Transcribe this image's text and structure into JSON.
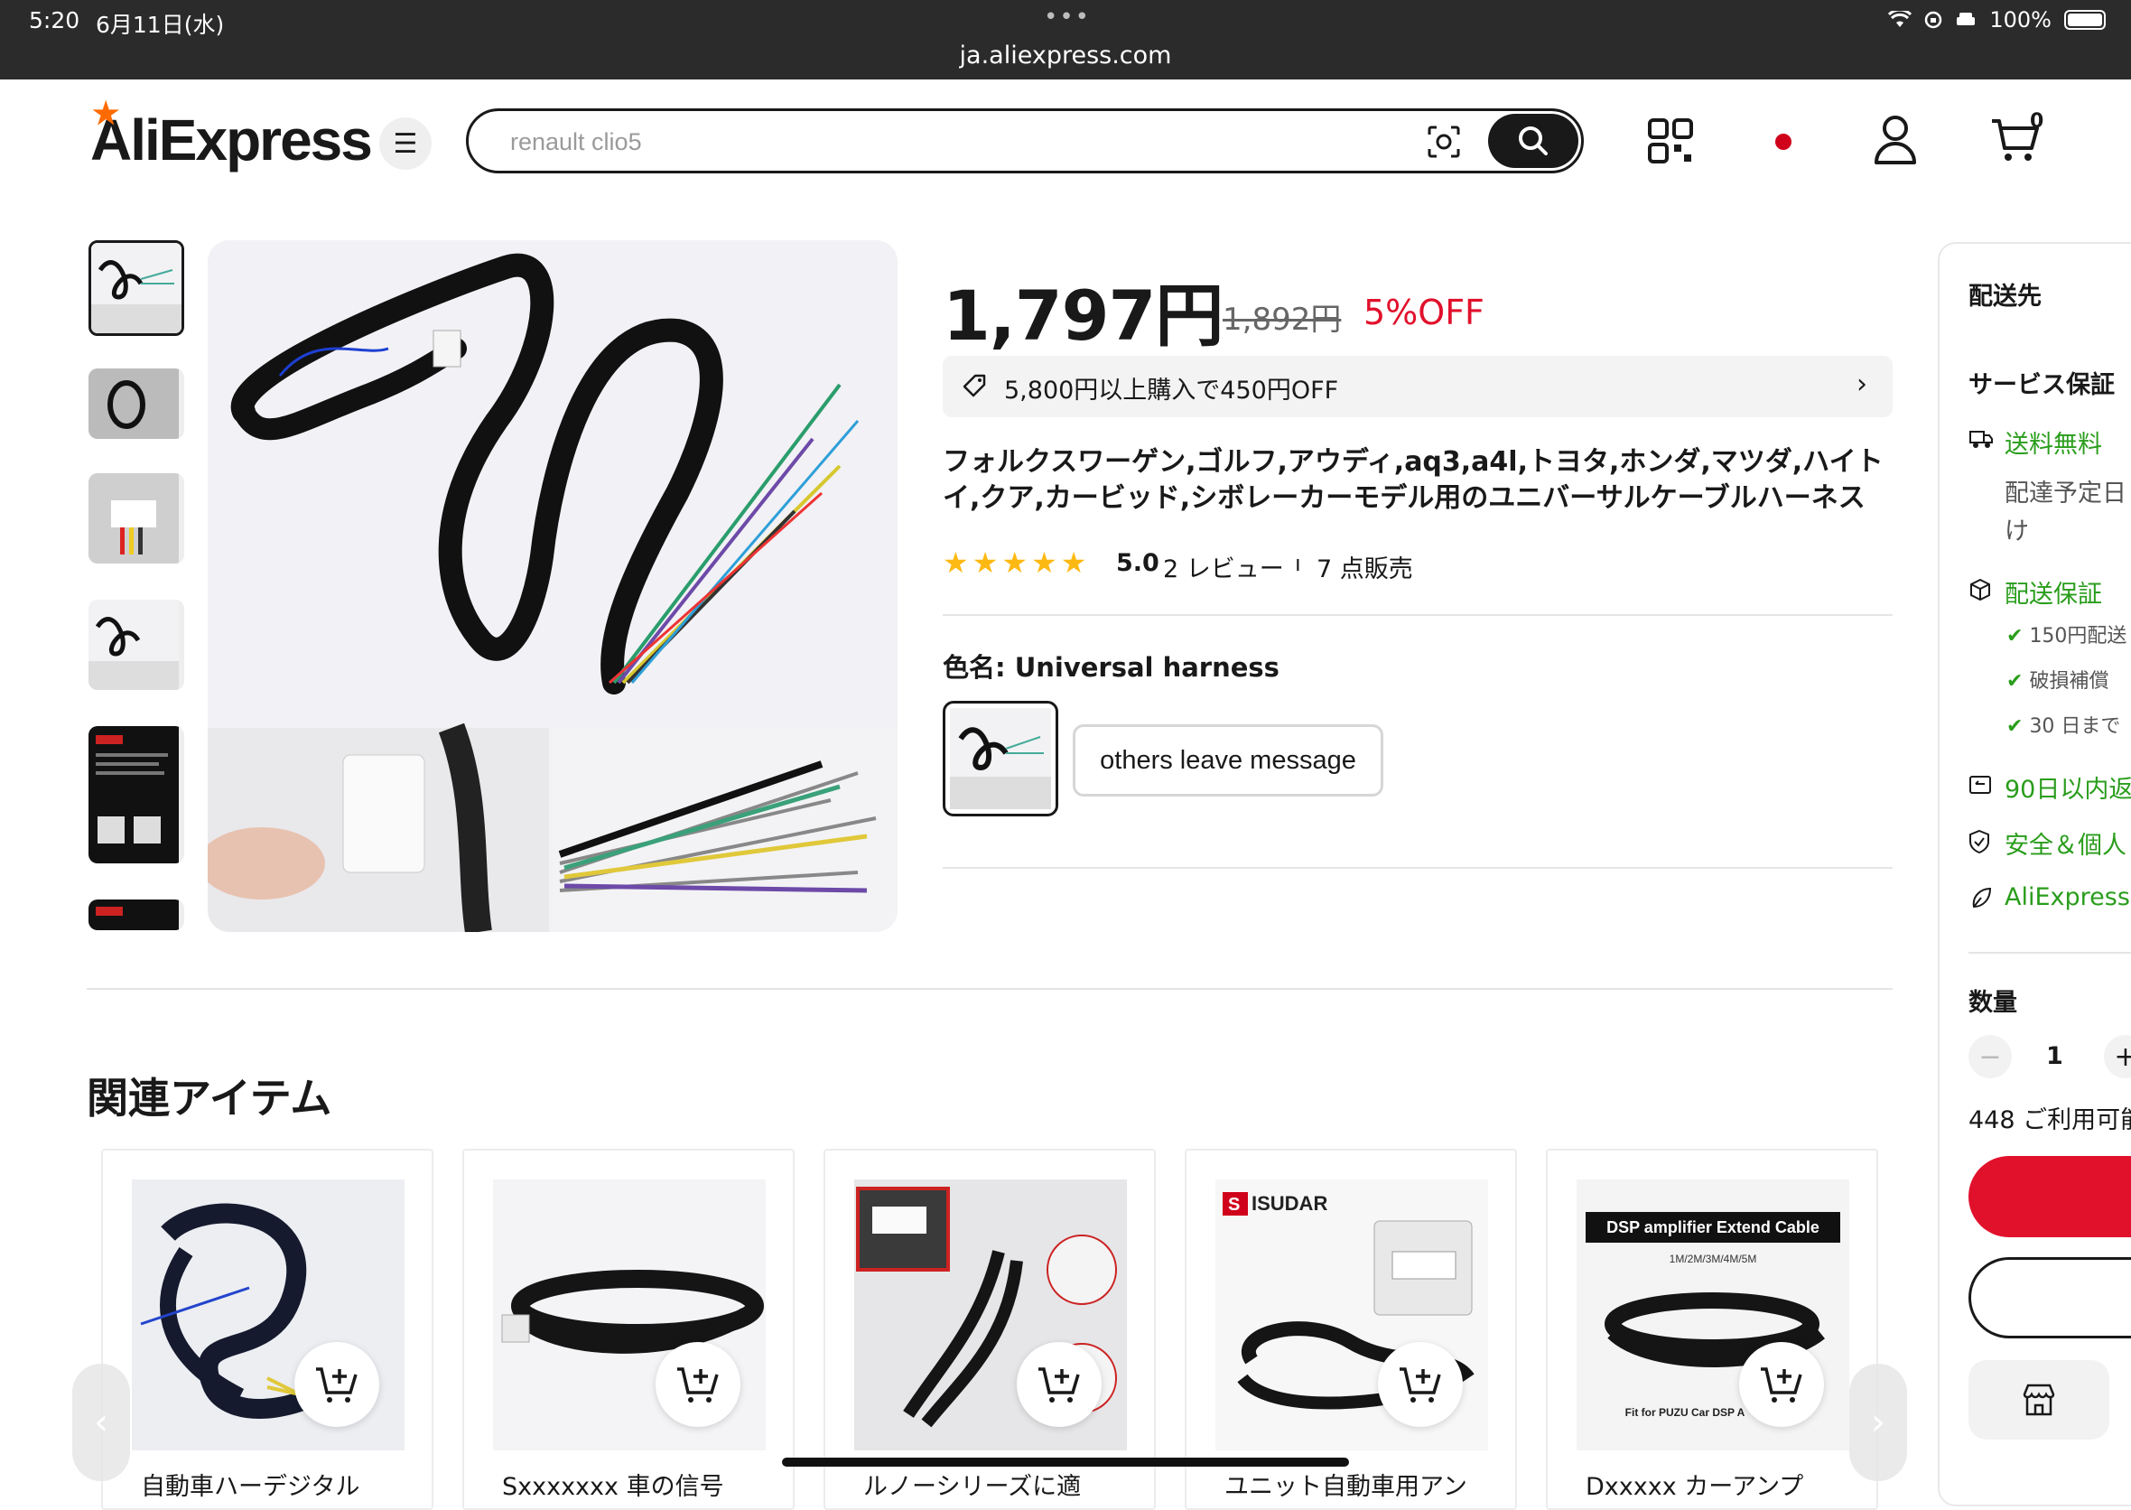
{
  "status_bar": {
    "time": "5:20",
    "date": "6月11日(水)",
    "url": "ja.aliexpress.com",
    "battery": "100%"
  },
  "header": {
    "logo": "AliExpress",
    "search_placeholder": "renault clio5",
    "cart_count": "0"
  },
  "product": {
    "price": "1,797円",
    "original_price": "1,892円",
    "discount": "5%OFF",
    "coupon": "5,800円以上購入で450円OFF",
    "title": "フォルクスワーゲン,ゴルフ,アウディ,aq3,a4l,トヨタ,ホンダ,マツダ,ハイトイ,クア,カービッド,シボレーカーモデル用のユニバーサルケーブルハーネス",
    "rating": "5.0",
    "rating_stars": 5,
    "reviews": "2 レビュー",
    "separator": "ı",
    "sold": "7 点販売",
    "color_label": "色名: Universal harness",
    "variants": [
      "others leave message"
    ]
  },
  "side_panel": {
    "ship_to": "配送先",
    "service_title": "サービス保証",
    "free_shipping": "送料無料",
    "delivery_estimate_1": "配達予定日",
    "delivery_estimate_2": "け",
    "delivery_guarantee": "配送保証",
    "guarantee_items": [
      "150円配送",
      "破損補償",
      "30 日まで"
    ],
    "returns": "90日以内返",
    "security": "安全＆個人",
    "aliexpress": "AliExpress",
    "quantity_label": "数量",
    "quantity_minus": "−",
    "quantity_value": "1",
    "quantity_plus": "+",
    "available": "448 ご利用可能"
  },
  "related": {
    "title": "関連アイテム",
    "items": [
      {
        "caption": "自動車ハーデジタル"
      },
      {
        "caption": "Sxxxxxxx 車の信号"
      },
      {
        "caption": "ルノーシリーズに適"
      },
      {
        "caption": "ユニット自動車用アン",
        "brand": "ISUDAR"
      },
      {
        "caption": "Dxxxxx カーアンプ",
        "banner": "DSP amplifier  Extend Cable",
        "sub": "1M/2M/3M/4M/5M",
        "foot": "Fit for PUZU Car DSP A"
      }
    ]
  },
  "colors": {
    "accent_red": "#e1112c",
    "green": "#2a9d1c",
    "star": "#fdb913"
  }
}
